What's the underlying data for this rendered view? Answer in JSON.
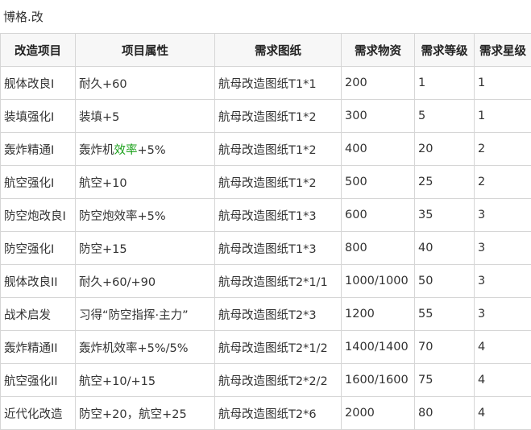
{
  "page": {
    "title": "博格.改"
  },
  "table": {
    "headers": [
      "改造项目",
      "项目属性",
      "需求图纸",
      "需求物资",
      "需求等级",
      "需求星级"
    ],
    "rows": [
      {
        "name": "舰体改良I",
        "attr_pre": "耐久+60",
        "attr_highlight": "",
        "attr_post": "",
        "blueprint": "航母改造图纸T1*1",
        "materials": "200",
        "level": "1",
        "stars": "1"
      },
      {
        "name": "装填强化I",
        "attr_pre": "装填+5",
        "attr_highlight": "",
        "attr_post": "",
        "blueprint": "航母改造图纸T1*2",
        "materials": "300",
        "level": "5",
        "stars": "1"
      },
      {
        "name": "轰炸精通I",
        "attr_pre": "轰炸机",
        "attr_highlight": "效率",
        "attr_post": "+5%",
        "blueprint": "航母改造图纸T1*2",
        "materials": "400",
        "level": "20",
        "stars": "2"
      },
      {
        "name": "航空强化I",
        "attr_pre": "航空+10",
        "attr_highlight": "",
        "attr_post": "",
        "blueprint": "航母改造图纸T1*2",
        "materials": "500",
        "level": "25",
        "stars": "2"
      },
      {
        "name": "防空炮改良I",
        "attr_pre": "防空炮效率+5%",
        "attr_highlight": "",
        "attr_post": "",
        "blueprint": "航母改造图纸T1*3",
        "materials": "600",
        "level": "35",
        "stars": "3"
      },
      {
        "name": "防空强化I",
        "attr_pre": "防空+15",
        "attr_highlight": "",
        "attr_post": "",
        "blueprint": "航母改造图纸T1*3",
        "materials": "800",
        "level": "40",
        "stars": "3"
      },
      {
        "name": "舰体改良II",
        "attr_pre": "耐久+60/+90",
        "attr_highlight": "",
        "attr_post": "",
        "blueprint": "航母改造图纸T2*1/1",
        "materials": "1000/1000",
        "level": "50",
        "stars": "3"
      },
      {
        "name": "战术启发",
        "attr_pre": "习得“防空指挥·主力”",
        "attr_highlight": "",
        "attr_post": "",
        "blueprint": "航母改造图纸T2*3",
        "materials": "1200",
        "level": "55",
        "stars": "3"
      },
      {
        "name": "轰炸精通II",
        "attr_pre": "轰炸机效率+5%/5%",
        "attr_highlight": "",
        "attr_post": "",
        "blueprint": "航母改造图纸T2*1/2",
        "materials": "1400/1400",
        "level": "70",
        "stars": "4"
      },
      {
        "name": "航空强化II",
        "attr_pre": "航空+10/+15",
        "attr_highlight": "",
        "attr_post": "",
        "blueprint": "航母改造图纸T2*2/2",
        "materials": "1600/1600",
        "level": "75",
        "stars": "4"
      },
      {
        "name": "近代化改造",
        "attr_pre": "防空+20，航空+25",
        "attr_highlight": "",
        "attr_post": "",
        "blueprint": "航母改造图纸T2*6",
        "materials": "2000",
        "level": "80",
        "stars": "4"
      }
    ]
  },
  "colors": {
    "highlight": "#1ba11b",
    "border": "#d6d6d6",
    "text": "#333333"
  }
}
